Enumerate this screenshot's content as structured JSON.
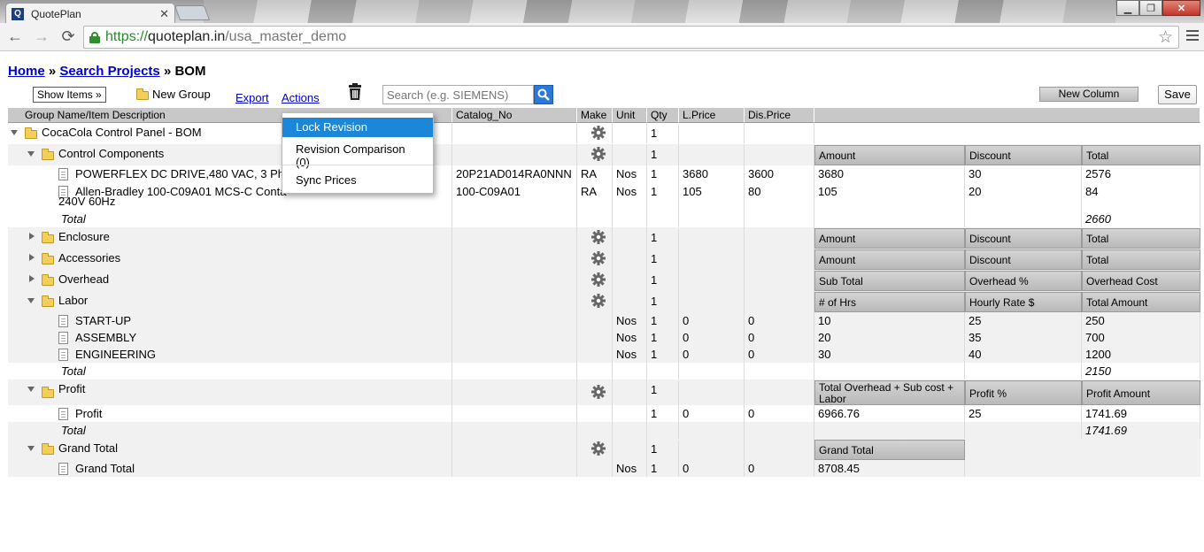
{
  "browser": {
    "tab_title": "QuotePlan",
    "tab_favicon": "Q",
    "url_scheme": "https://",
    "url_host": "quoteplan.in",
    "url_path": "/usa_master_demo"
  },
  "breadcrumb": {
    "home": "Home",
    "sep": "»",
    "search": "Search Projects",
    "current": "BOM"
  },
  "toolbar": {
    "show_items": "Show Items »",
    "new_group": "New Group",
    "export": "Export",
    "actions": "Actions",
    "search_placeholder": "Search (e.g. SIEMENS)",
    "new_column": "New Column",
    "save": "Save"
  },
  "actions_menu": {
    "items": [
      "Lock Revision",
      "Revision Comparison (0)",
      "Sync Prices"
    ]
  },
  "grid": {
    "headers": [
      "Group Name/Item Description",
      "Catalog_No",
      "Make",
      "Unit",
      "Qty",
      "L.Price",
      "Dis.Price"
    ],
    "rows": [
      {
        "type": "group",
        "name": "CocaCola Control Panel - BOM",
        "qty": "1"
      },
      {
        "type": "group",
        "name": "Control Components",
        "qty": "1",
        "sub": [
          "Amount",
          "Discount",
          "Total"
        ]
      },
      {
        "type": "item",
        "name": "POWERFLEX DC DRIVE,480 VAC, 3 Ph",
        "catalog": "20P21AD014RA0NNN",
        "make": "RA",
        "unit": "Nos",
        "qty": "1",
        "lprice": "3680",
        "dprice": "3600",
        "ext": [
          "3680",
          "30",
          "2576"
        ]
      },
      {
        "type": "item",
        "name": "Allen-Bradley 100-C09A01 MCS-C Conta",
        "name2": "240V 60Hz",
        "catalog": "100-C09A01",
        "make": "RA",
        "unit": "Nos",
        "qty": "1",
        "lprice": "105",
        "dprice": "80",
        "ext": [
          "105",
          "20",
          "84"
        ]
      },
      {
        "type": "total",
        "name": "Total",
        "total": "2660"
      },
      {
        "type": "group",
        "name": "Enclosure",
        "qty": "1",
        "sub": [
          "Amount",
          "Discount",
          "Total"
        ]
      },
      {
        "type": "group",
        "name": "Accessories",
        "qty": "1",
        "sub": [
          "Amount",
          "Discount",
          "Total"
        ]
      },
      {
        "type": "group",
        "name": "Overhead",
        "qty": "1",
        "sub": [
          "Sub Total",
          "Overhead %",
          "Overhead Cost"
        ]
      },
      {
        "type": "group",
        "name": "Labor",
        "qty": "1",
        "sub": [
          "# of Hrs",
          "Hourly Rate $",
          "Total Amount"
        ]
      },
      {
        "type": "item",
        "name": "START-UP",
        "unit": "Nos",
        "qty": "1",
        "lprice": "0",
        "dprice": "0",
        "ext": [
          "10",
          "25",
          "250"
        ]
      },
      {
        "type": "item",
        "name": "ASSEMBLY",
        "unit": "Nos",
        "qty": "1",
        "lprice": "0",
        "dprice": "0",
        "ext": [
          "20",
          "35",
          "700"
        ]
      },
      {
        "type": "item",
        "name": "ENGINEERING",
        "unit": "Nos",
        "qty": "1",
        "lprice": "0",
        "dprice": "0",
        "ext": [
          "30",
          "40",
          "1200"
        ]
      },
      {
        "type": "total",
        "name": "Total",
        "total": "2150"
      },
      {
        "type": "group",
        "name": "Profit",
        "qty": "1",
        "sub": [
          "Total Overhead + Sub cost + Labor",
          "Profit %",
          "Profit Amount"
        ]
      },
      {
        "type": "item",
        "name": "Profit",
        "qty": "1",
        "lprice": "0",
        "dprice": "0",
        "ext": [
          "6966.76",
          "25",
          "1741.69"
        ]
      },
      {
        "type": "total",
        "name": "Total",
        "total": "1741.69"
      },
      {
        "type": "group",
        "name": "Grand Total",
        "qty": "1",
        "sub": [
          "Grand Total"
        ]
      },
      {
        "type": "item",
        "name": "Grand Total",
        "unit": "Nos",
        "qty": "1",
        "lprice": "0",
        "dprice": "0",
        "ext": [
          "8708.45"
        ]
      }
    ]
  }
}
